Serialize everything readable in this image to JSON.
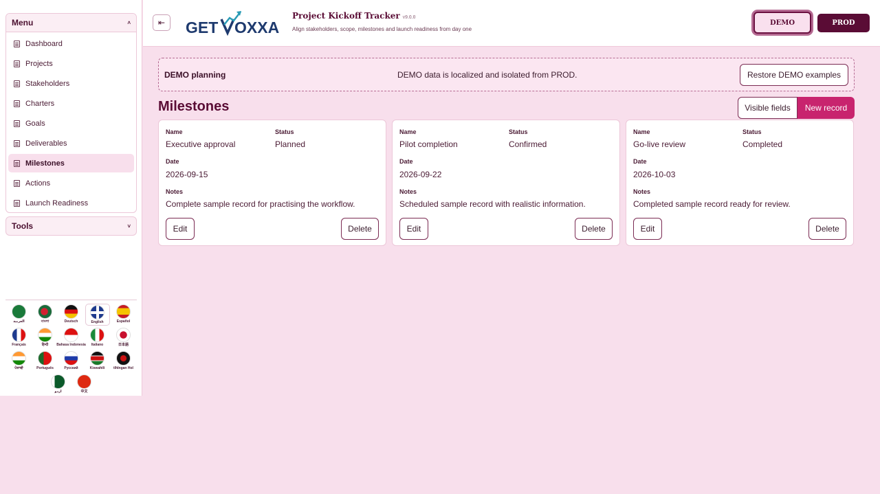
{
  "sidebar": {
    "menu_title": "Menu",
    "menu_caret": "˄",
    "items": [
      {
        "label": "Dashboard",
        "active": false
      },
      {
        "label": "Projects",
        "active": false
      },
      {
        "label": "Stakeholders",
        "active": false
      },
      {
        "label": "Charters",
        "active": false
      },
      {
        "label": "Goals",
        "active": false
      },
      {
        "label": "Deliverables",
        "active": false
      },
      {
        "label": "Milestones",
        "active": true
      },
      {
        "label": "Actions",
        "active": false
      },
      {
        "label": "Launch Readiness",
        "active": false
      }
    ],
    "tools_title": "Tools",
    "tools_caret": "˅"
  },
  "languages": [
    {
      "label": "العربية",
      "flag": "sa"
    },
    {
      "label": "বাংলা",
      "flag": "bd"
    },
    {
      "label": "Deutsch",
      "flag": "de"
    },
    {
      "label": "English",
      "flag": "gb",
      "selected": true
    },
    {
      "label": "Español",
      "flag": "es"
    },
    {
      "label": "Français",
      "flag": "fr"
    },
    {
      "label": "हिन्दी",
      "flag": "in"
    },
    {
      "label": "Bahasa Indonesia",
      "flag": "id"
    },
    {
      "label": "Italiano",
      "flag": "it"
    },
    {
      "label": "日本語",
      "flag": "jp"
    },
    {
      "label": "ਪੰਜਾਬੀ",
      "flag": "in"
    },
    {
      "label": "Português",
      "flag": "pt"
    },
    {
      "label": "Русский",
      "flag": "ru"
    },
    {
      "label": "Kiswahili",
      "flag": "ke"
    },
    {
      "label": "tlhIngan Hol",
      "flag": "kl"
    },
    {
      "label": "اردو",
      "flag": "pk"
    },
    {
      "label": "中文",
      "flag": "cn"
    }
  ],
  "header": {
    "collapse_icon": "⇤",
    "logo_text_left": "GET",
    "logo_text_right": "OXXA",
    "app_title": "Project Kickoff Tracker",
    "version": "v9.0.0",
    "subtitle": "Align stakeholders, scope, milestones and launch readiness from day one",
    "env_demo": "DEMO",
    "env_prod": "PROD"
  },
  "banner": {
    "title": "DEMO planning",
    "message": "DEMO data is localized and isolated from PROD.",
    "restore_label": "Restore DEMO examples"
  },
  "section": {
    "title": "Milestones",
    "visible_fields_label": "Visible fields",
    "new_record_label": "New record"
  },
  "field_labels": {
    "name": "Name",
    "status": "Status",
    "date": "Date",
    "notes": "Notes",
    "edit": "Edit",
    "delete": "Delete"
  },
  "cards": [
    {
      "name": "Executive approval",
      "status": "Planned",
      "date": "2026-09-15",
      "notes": "Complete sample record for practising the workflow."
    },
    {
      "name": "Pilot completion",
      "status": "Confirmed",
      "date": "2026-09-22",
      "notes": "Scheduled sample record with realistic information."
    },
    {
      "name": "Go-live review",
      "status": "Completed",
      "date": "2026-10-03",
      "notes": "Completed sample record ready for review."
    }
  ],
  "colors": {
    "accent": "#c8246e",
    "brand_dark": "#5a0c35",
    "background": "#f8dfec"
  }
}
